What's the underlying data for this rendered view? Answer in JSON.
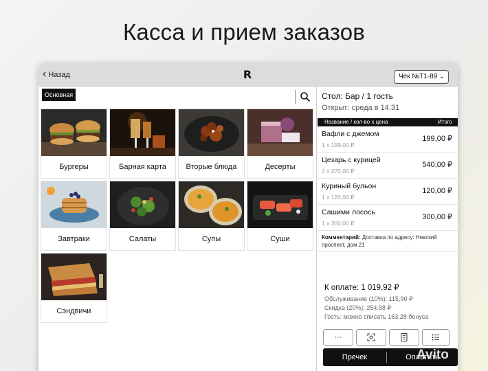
{
  "slide": {
    "title": "Касса и прием заказов"
  },
  "topbar": {
    "back_label": "Назад",
    "logo_text": "R",
    "check_label": "Чек №Т1-89"
  },
  "menu": {
    "category": "Основная",
    "items": [
      {
        "label": "Бургеры",
        "image": "burgers-photo"
      },
      {
        "label": "Барная карта",
        "image": "bar-drinks-photo"
      },
      {
        "label": "Вторые блюда",
        "image": "main-dish-photo"
      },
      {
        "label": "Десерты",
        "image": "desserts-photo"
      },
      {
        "label": "Завтраки",
        "image": "pancakes-photo"
      },
      {
        "label": "Салаты",
        "image": "salad-photo"
      },
      {
        "label": "Супы",
        "image": "soup-photo"
      },
      {
        "label": "Суши",
        "image": "sushi-photo"
      },
      {
        "label": "Сэндвичи",
        "image": "sandwich-photo"
      }
    ]
  },
  "order": {
    "table": "Стол: Бар / 1 гость",
    "opened": "Открыт: среда в 14:31",
    "header_left": "Название / кол-во x цена",
    "header_right": "Итого",
    "items": [
      {
        "name": "Вафли с джемом",
        "qty": "1 x 199,00 ₽",
        "sum": "199,00 ₽"
      },
      {
        "name": "Цезарь с курицей",
        "qty": "2 x 270,00 ₽",
        "sum": "540,00 ₽"
      },
      {
        "name": "Куриный бульон",
        "qty": "1 x 120,00 ₽",
        "sum": "120,00 ₽"
      },
      {
        "name": "Сашими лосось",
        "qty": "1 x 300,00 ₽",
        "sum": "300,00 ₽"
      }
    ],
    "comment_label": "Комментарий:",
    "comment_text": "Доставка по адресу: Невский проспект, дом 21",
    "to_pay": "К оплате: 1 019,92 ₽",
    "service": "Обслуживание (10%): 115,90 ₽",
    "discount": "Скидка (20%): 254,98 ₽",
    "bonus": "Гость: можно списать 163,28 бонуса",
    "actions": [
      {
        "label": "···",
        "icon": "more-icon"
      },
      {
        "label": "",
        "icon": "scan-icon"
      },
      {
        "label": "",
        "icon": "receipt-icon"
      },
      {
        "label": "",
        "icon": "list-icon"
      }
    ],
    "precheck_label": "Пречек",
    "pay_label": "Оплатить"
  },
  "watermark": "Avito",
  "colors": {
    "accent": "#111111",
    "topbar": "#dcdcdc"
  }
}
